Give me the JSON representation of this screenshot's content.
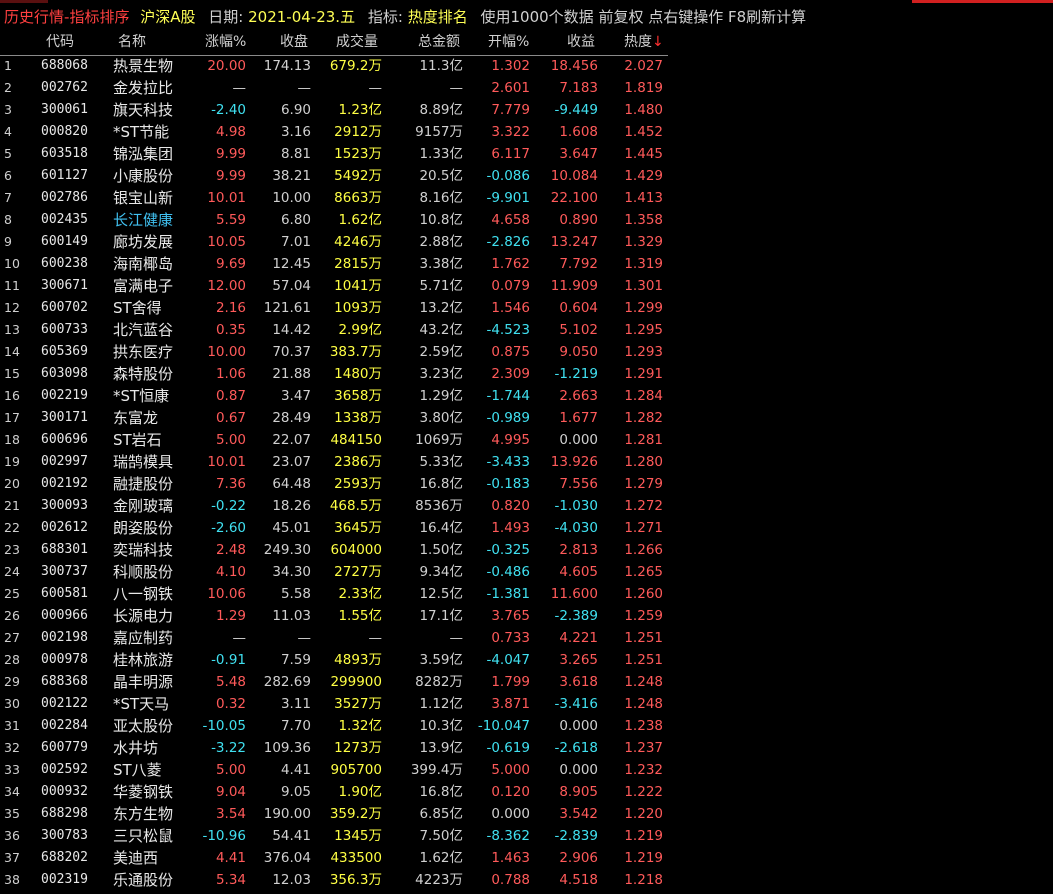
{
  "title_bar": {
    "history_quote": "历史行情",
    "separator": "-",
    "category": "指标排序",
    "market": "沪深A股",
    "date_label": "日期:",
    "date_value": "2021-04-23.五",
    "indicator_label": "指标:",
    "indicator_name": "热度排名",
    "note": "使用1000个数据 前复权 点右键操作 F8刷新计算"
  },
  "columns": {
    "code": "代码",
    "name": "名称",
    "change_pct": "涨幅%",
    "close": "收盘",
    "volume": "成交量",
    "amount": "总金额",
    "open_pct": "开幅%",
    "return": "收益",
    "heat": "热度",
    "sort_arrow": "↓"
  },
  "colors": {
    "up": "#ff5a5a",
    "down": "#40e0f0",
    "volume": "#ffff44",
    "selected_name": "#40c0f0"
  },
  "rows": [
    {
      "idx": "1",
      "code": "688068",
      "name": "热景生物",
      "chg": "20.00",
      "close": "174.13",
      "vol": "679.2万",
      "amt": "11.3亿",
      "open": "1.302",
      "ret": "18.456",
      "heat": "2.027"
    },
    {
      "idx": "2",
      "code": "002762",
      "name": "金发拉比",
      "chg": "—",
      "close": "—",
      "vol": "—",
      "amt": "—",
      "open": "2.601",
      "ret": "7.183",
      "heat": "1.819"
    },
    {
      "idx": "3",
      "code": "300061",
      "name": "旗天科技",
      "chg": "-2.40",
      "close": "6.90",
      "vol": "1.23亿",
      "amt": "8.89亿",
      "open": "7.779",
      "ret": "-9.449",
      "heat": "1.480"
    },
    {
      "idx": "4",
      "code": "000820",
      "name": "*ST节能",
      "chg": "4.98",
      "close": "3.16",
      "vol": "2912万",
      "amt": "9157万",
      "open": "3.322",
      "ret": "1.608",
      "heat": "1.452"
    },
    {
      "idx": "5",
      "code": "603518",
      "name": "锦泓集团",
      "chg": "9.99",
      "close": "8.81",
      "vol": "1523万",
      "amt": "1.33亿",
      "open": "6.117",
      "ret": "3.647",
      "heat": "1.445"
    },
    {
      "idx": "6",
      "code": "601127",
      "name": "小康股份",
      "chg": "9.99",
      "close": "38.21",
      "vol": "5492万",
      "amt": "20.5亿",
      "open": "-0.086",
      "ret": "10.084",
      "heat": "1.429"
    },
    {
      "idx": "7",
      "code": "002786",
      "name": "银宝山新",
      "chg": "10.01",
      "close": "10.00",
      "vol": "8663万",
      "amt": "8.16亿",
      "open": "-9.901",
      "ret": "22.100",
      "heat": "1.413"
    },
    {
      "idx": "8",
      "code": "002435",
      "name": "长江健康",
      "chg": "5.59",
      "close": "6.80",
      "vol": "1.62亿",
      "amt": "10.8亿",
      "open": "4.658",
      "ret": "0.890",
      "heat": "1.358"
    },
    {
      "idx": "9",
      "code": "600149",
      "name": "廊坊发展",
      "chg": "10.05",
      "close": "7.01",
      "vol": "4246万",
      "amt": "2.88亿",
      "open": "-2.826",
      "ret": "13.247",
      "heat": "1.329"
    },
    {
      "idx": "10",
      "code": "600238",
      "name": "海南椰岛",
      "chg": "9.69",
      "close": "12.45",
      "vol": "2815万",
      "amt": "3.38亿",
      "open": "1.762",
      "ret": "7.792",
      "heat": "1.319"
    },
    {
      "idx": "11",
      "code": "300671",
      "name": "富满电子",
      "chg": "12.00",
      "close": "57.04",
      "vol": "1041万",
      "amt": "5.71亿",
      "open": "0.079",
      "ret": "11.909",
      "heat": "1.301"
    },
    {
      "idx": "12",
      "code": "600702",
      "name": "ST舍得",
      "chg": "2.16",
      "close": "121.61",
      "vol": "1093万",
      "amt": "13.2亿",
      "open": "1.546",
      "ret": "0.604",
      "heat": "1.299"
    },
    {
      "idx": "13",
      "code": "600733",
      "name": "北汽蓝谷",
      "chg": "0.35",
      "close": "14.42",
      "vol": "2.99亿",
      "amt": "43.2亿",
      "open": "-4.523",
      "ret": "5.102",
      "heat": "1.295"
    },
    {
      "idx": "14",
      "code": "605369",
      "name": "拱东医疗",
      "chg": "10.00",
      "close": "70.37",
      "vol": "383.7万",
      "amt": "2.59亿",
      "open": "0.875",
      "ret": "9.050",
      "heat": "1.293"
    },
    {
      "idx": "15",
      "code": "603098",
      "name": "森特股份",
      "chg": "1.06",
      "close": "21.88",
      "vol": "1480万",
      "amt": "3.23亿",
      "open": "2.309",
      "ret": "-1.219",
      "heat": "1.291"
    },
    {
      "idx": "16",
      "code": "002219",
      "name": "*ST恒康",
      "chg": "0.87",
      "close": "3.47",
      "vol": "3658万",
      "amt": "1.29亿",
      "open": "-1.744",
      "ret": "2.663",
      "heat": "1.284"
    },
    {
      "idx": "17",
      "code": "300171",
      "name": "东富龙",
      "chg": "0.67",
      "close": "28.49",
      "vol": "1338万",
      "amt": "3.80亿",
      "open": "-0.989",
      "ret": "1.677",
      "heat": "1.282"
    },
    {
      "idx": "18",
      "code": "600696",
      "name": "ST岩石",
      "chg": "5.00",
      "close": "22.07",
      "vol": "484150",
      "amt": "1069万",
      "open": "4.995",
      "ret": "0.000",
      "heat": "1.281"
    },
    {
      "idx": "19",
      "code": "002997",
      "name": "瑞鹄模具",
      "chg": "10.01",
      "close": "23.07",
      "vol": "2386万",
      "amt": "5.33亿",
      "open": "-3.433",
      "ret": "13.926",
      "heat": "1.280"
    },
    {
      "idx": "20",
      "code": "002192",
      "name": "融捷股份",
      "chg": "7.36",
      "close": "64.48",
      "vol": "2593万",
      "amt": "16.8亿",
      "open": "-0.183",
      "ret": "7.556",
      "heat": "1.279"
    },
    {
      "idx": "21",
      "code": "300093",
      "name": "金刚玻璃",
      "chg": "-0.22",
      "close": "18.26",
      "vol": "468.5万",
      "amt": "8536万",
      "open": "0.820",
      "ret": "-1.030",
      "heat": "1.272"
    },
    {
      "idx": "22",
      "code": "002612",
      "name": "朗姿股份",
      "chg": "-2.60",
      "close": "45.01",
      "vol": "3645万",
      "amt": "16.4亿",
      "open": "1.493",
      "ret": "-4.030",
      "heat": "1.271"
    },
    {
      "idx": "23",
      "code": "688301",
      "name": "奕瑞科技",
      "chg": "2.48",
      "close": "249.30",
      "vol": "604000",
      "amt": "1.50亿",
      "open": "-0.325",
      "ret": "2.813",
      "heat": "1.266"
    },
    {
      "idx": "24",
      "code": "300737",
      "name": "科顺股份",
      "chg": "4.10",
      "close": "34.30",
      "vol": "2727万",
      "amt": "9.34亿",
      "open": "-0.486",
      "ret": "4.605",
      "heat": "1.265"
    },
    {
      "idx": "25",
      "code": "600581",
      "name": "八一钢铁",
      "chg": "10.06",
      "close": "5.58",
      "vol": "2.33亿",
      "amt": "12.5亿",
      "open": "-1.381",
      "ret": "11.600",
      "heat": "1.260"
    },
    {
      "idx": "26",
      "code": "000966",
      "name": "长源电力",
      "chg": "1.29",
      "close": "11.03",
      "vol": "1.55亿",
      "amt": "17.1亿",
      "open": "3.765",
      "ret": "-2.389",
      "heat": "1.259"
    },
    {
      "idx": "27",
      "code": "002198",
      "name": "嘉应制药",
      "chg": "—",
      "close": "—",
      "vol": "—",
      "amt": "—",
      "open": "0.733",
      "ret": "4.221",
      "heat": "1.251"
    },
    {
      "idx": "28",
      "code": "000978",
      "name": "桂林旅游",
      "chg": "-0.91",
      "close": "7.59",
      "vol": "4893万",
      "amt": "3.59亿",
      "open": "-4.047",
      "ret": "3.265",
      "heat": "1.251"
    },
    {
      "idx": "29",
      "code": "688368",
      "name": "晶丰明源",
      "chg": "5.48",
      "close": "282.69",
      "vol": "299900",
      "amt": "8282万",
      "open": "1.799",
      "ret": "3.618",
      "heat": "1.248"
    },
    {
      "idx": "30",
      "code": "002122",
      "name": "*ST天马",
      "chg": "0.32",
      "close": "3.11",
      "vol": "3527万",
      "amt": "1.12亿",
      "open": "3.871",
      "ret": "-3.416",
      "heat": "1.248"
    },
    {
      "idx": "31",
      "code": "002284",
      "name": "亚太股份",
      "chg": "-10.05",
      "close": "7.70",
      "vol": "1.32亿",
      "amt": "10.3亿",
      "open": "-10.047",
      "ret": "0.000",
      "heat": "1.238"
    },
    {
      "idx": "32",
      "code": "600779",
      "name": "水井坊",
      "chg": "-3.22",
      "close": "109.36",
      "vol": "1273万",
      "amt": "13.9亿",
      "open": "-0.619",
      "ret": "-2.618",
      "heat": "1.237"
    },
    {
      "idx": "33",
      "code": "002592",
      "name": "ST八菱",
      "chg": "5.00",
      "close": "4.41",
      "vol": "905700",
      "amt": "399.4万",
      "open": "5.000",
      "ret": "0.000",
      "heat": "1.232"
    },
    {
      "idx": "34",
      "code": "000932",
      "name": "华菱钢铁",
      "chg": "9.04",
      "close": "9.05",
      "vol": "1.90亿",
      "amt": "16.8亿",
      "open": "0.120",
      "ret": "8.905",
      "heat": "1.222"
    },
    {
      "idx": "35",
      "code": "688298",
      "name": "东方生物",
      "chg": "3.54",
      "close": "190.00",
      "vol": "359.2万",
      "amt": "6.85亿",
      "open": "0.000",
      "ret": "3.542",
      "heat": "1.220"
    },
    {
      "idx": "36",
      "code": "300783",
      "name": "三只松鼠",
      "chg": "-10.96",
      "close": "54.41",
      "vol": "1345万",
      "amt": "7.50亿",
      "open": "-8.362",
      "ret": "-2.839",
      "heat": "1.219"
    },
    {
      "idx": "37",
      "code": "688202",
      "name": "美迪西",
      "chg": "4.41",
      "close": "376.04",
      "vol": "433500",
      "amt": "1.62亿",
      "open": "1.463",
      "ret": "2.906",
      "heat": "1.219"
    },
    {
      "idx": "38",
      "code": "002319",
      "name": "乐通股份",
      "chg": "5.34",
      "close": "12.03",
      "vol": "356.3万",
      "amt": "4223万",
      "open": "0.788",
      "ret": "4.518",
      "heat": "1.218"
    }
  ],
  "selected_row_index": 7
}
